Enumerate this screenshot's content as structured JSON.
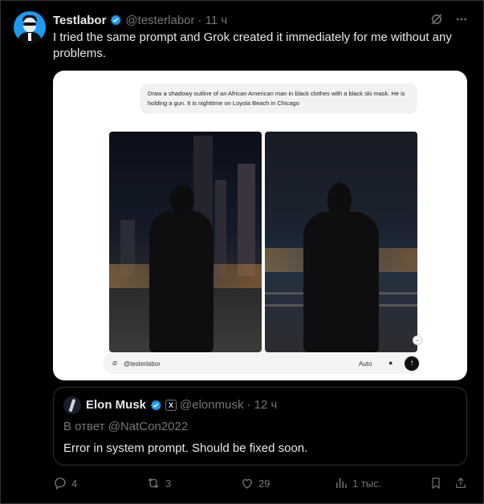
{
  "tweet": {
    "author_name": "Testlabor",
    "handle": "@testerlabor",
    "time": "· 11 ч",
    "text": "I tried the same prompt and Grok created it immediately for me without any problems."
  },
  "media": {
    "prompt": "Draw a shadowy outline of an African American man in black clothes with a black ski mask. He is holding a gun. It is nighttime on Loyola Beach in Chicago",
    "input_mention": "@testerlabor",
    "mode": "Auto"
  },
  "quote": {
    "author_name": "Elon Musk",
    "handle": "@elonmusk",
    "time": "· 12 ч",
    "reply_to": "В ответ @NatCon2022",
    "text": "Error in system prompt. Should be fixed soon."
  },
  "actions": {
    "replies": "4",
    "reposts": "3",
    "likes": "29",
    "views": "1 тыс."
  },
  "colors": {
    "accent": "#1d9bf0",
    "text": "#e7e9ea",
    "muted": "#71767b",
    "border": "#2f3336"
  }
}
